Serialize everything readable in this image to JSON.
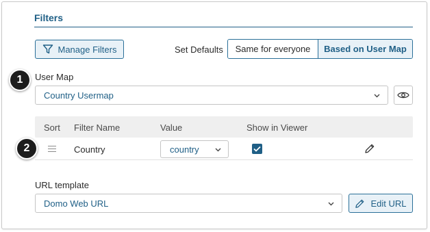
{
  "filters": {
    "title": "Filters",
    "manage_label": "Manage Filters",
    "set_defaults_label": "Set Defaults",
    "defaults_options": [
      "Same for everyone",
      "Based on User Map"
    ],
    "defaults_selected": "Based on User Map"
  },
  "user_map": {
    "label": "User Map",
    "value": "Country Usermap"
  },
  "table": {
    "headers": [
      "Sort",
      "Filter Name",
      "Value",
      "Show in Viewer"
    ],
    "rows": [
      {
        "name": "Country",
        "value": "country",
        "show_in_viewer": true
      }
    ]
  },
  "url_template": {
    "label": "URL template",
    "value": "Domo Web URL",
    "edit_label": "Edit URL"
  },
  "callouts": [
    "1",
    "2"
  ],
  "colors": {
    "accent": "#1f5f86",
    "accent_bg": "#e8f1f7",
    "header_bg": "#efefef"
  },
  "icons": [
    "filter-icon",
    "chevron-down-icon",
    "eye-icon",
    "drag-handle-icon",
    "checkmark-icon",
    "pencil-icon"
  ]
}
